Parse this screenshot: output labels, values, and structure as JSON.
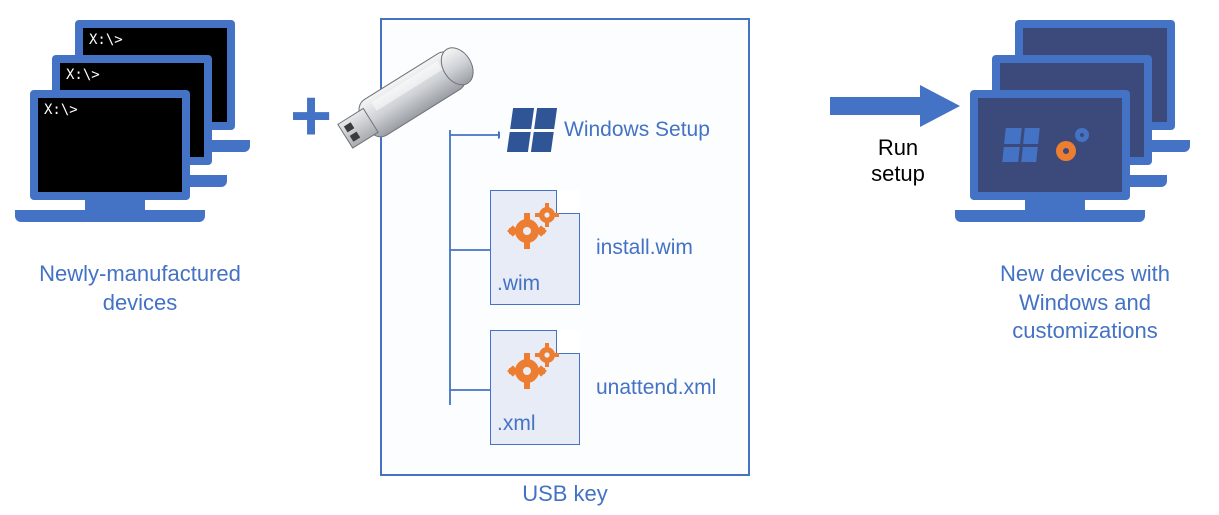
{
  "left": {
    "prompt": "X:\\>",
    "caption": "Newly-manufactured devices"
  },
  "plus": "+",
  "usb": {
    "caption": "USB key",
    "items": {
      "setup": "Windows Setup",
      "wim_ext": ".wim",
      "wim_name": "install.wim",
      "xml_ext": ".xml",
      "xml_name": "unattend.xml"
    }
  },
  "arrow": {
    "caption": "Run setup"
  },
  "right": {
    "caption": "New devices with Windows and customizations"
  },
  "icons": {
    "laptop": "laptop-icon",
    "usb": "usb-drive-icon",
    "windows": "windows-logo-icon",
    "file": "file-icon",
    "gear": "gear-icon",
    "arrow": "arrow-right-icon"
  },
  "colors": {
    "blue": "#4472c4",
    "darkblue": "#2f5597",
    "orange": "#ed7d31",
    "filebg": "#e7ecf7"
  }
}
